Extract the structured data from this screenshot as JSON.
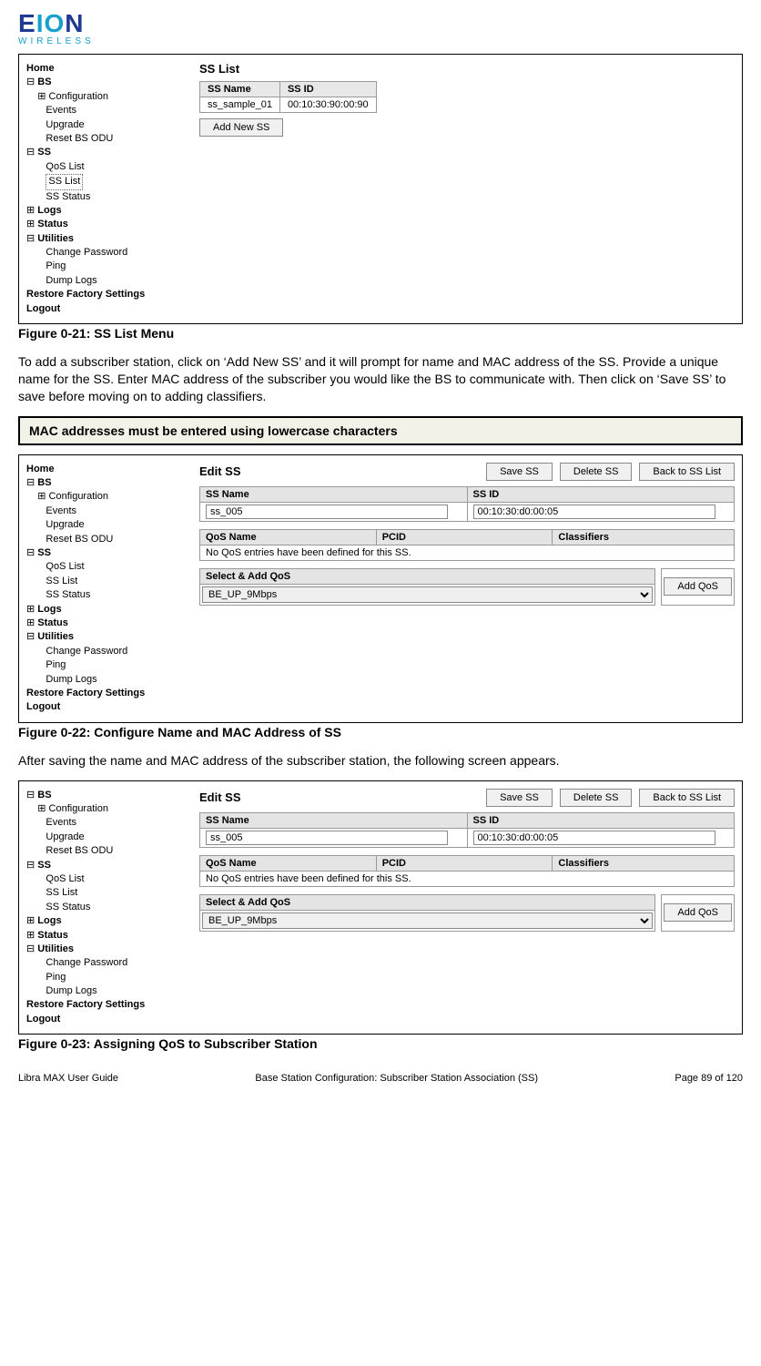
{
  "logo": {
    "main1": "E",
    "main2": "IO",
    "main3": "N",
    "sub": "WIRELESS"
  },
  "nav": {
    "home": "Home",
    "bs": "BS",
    "bs_items": [
      "Configuration",
      "Events",
      "Upgrade",
      "Reset BS ODU"
    ],
    "ss": "SS",
    "ss_items": [
      "QoS List",
      "SS List",
      "SS Status"
    ],
    "logs": "Logs",
    "status": "Status",
    "utilities": "Utilities",
    "util_items": [
      "Change Password",
      "Ping",
      "Dump Logs"
    ],
    "restore": "Restore Factory Settings",
    "logout": "Logout",
    "plus": "⊞",
    "minus": "⊟"
  },
  "fig1": {
    "title": "SS List",
    "col1": "SS Name",
    "col2": "SS ID",
    "row_name": "ss_sample_01",
    "row_id": "00:10:30:90:00:90",
    "add_btn": "Add New SS",
    "caption": "Figure 0-21: SS List Menu"
  },
  "p1": "To add a subscriber station, click on ‘Add New SS’ and it will prompt for name and MAC address of the SS. Provide a unique name for the SS. Enter MAC address of the subscriber you would like the BS to communicate with. Then click on ‘Save SS’ to save before moving on to adding classifiers.",
  "note": "MAC addresses must be entered using lowercase characters",
  "edit": {
    "title": "Edit SS",
    "save": "Save SS",
    "del": "Delete SS",
    "back": "Back to SS List",
    "name_h": "SS Name",
    "id_h": "SS ID",
    "name_v": "ss_005",
    "id_v": "00:10:30:d0:00:05",
    "qos_h1": "QoS Name",
    "qos_h2": "PCID",
    "qos_h3": "Classifiers",
    "qos_empty": "No QoS entries have been defined for this SS.",
    "sel_head": "Select & Add QoS",
    "sel_val": "BE_UP_9Mbps",
    "add_qos": "Add QoS"
  },
  "fig2_caption": "Figure 0-22: Configure Name and MAC Address of SS",
  "p2": "After saving the name and MAC address of the subscriber station, the following screen appears.",
  "fig3_caption": "Figure 0-23: Assigning QoS to Subscriber Station",
  "footer": {
    "left": "Libra MAX User Guide",
    "center": "Base Station Configuration: Subscriber Station Association (SS)",
    "right": "Page 89 of 120"
  }
}
